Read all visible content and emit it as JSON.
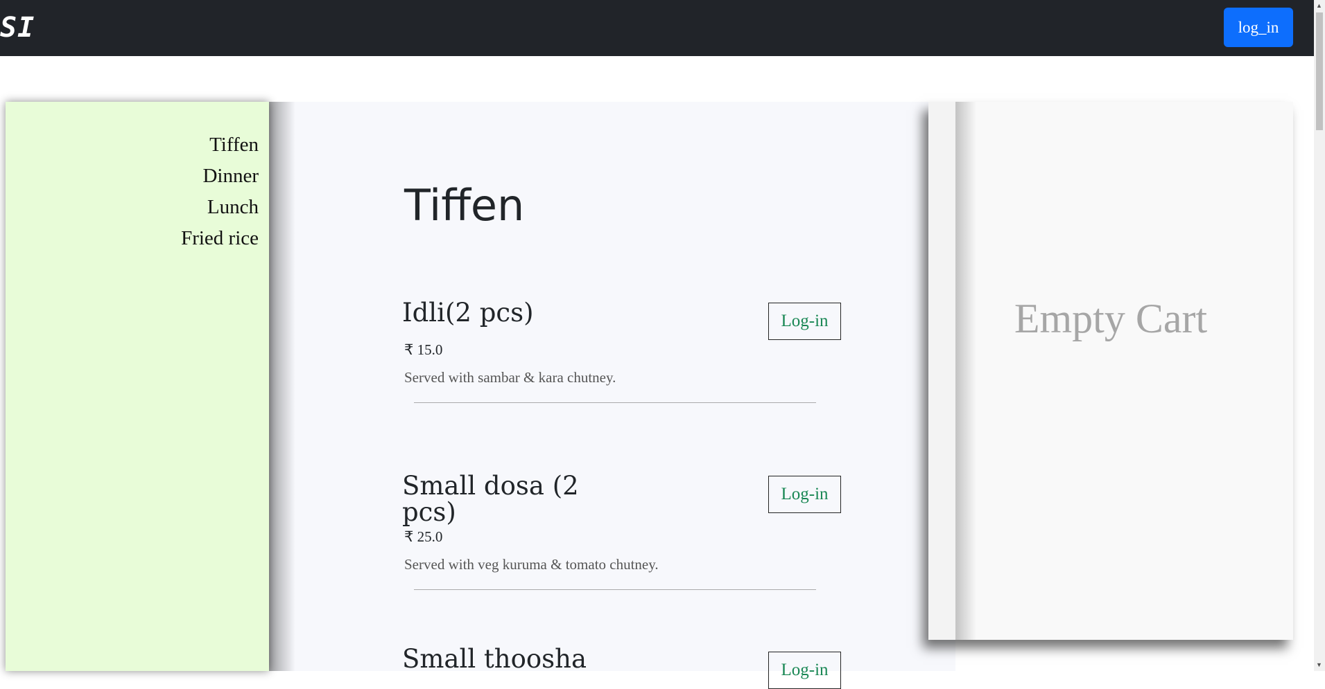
{
  "navbar": {
    "brand": "SI",
    "login_label": "log_in"
  },
  "sidebar": {
    "items": [
      {
        "label": "Tiffen"
      },
      {
        "label": "Dinner"
      },
      {
        "label": "Lunch"
      },
      {
        "label": "Fried rice"
      }
    ]
  },
  "main": {
    "section_title": "Tiffen",
    "items": [
      {
        "name": "Idli(2 pcs)",
        "price": "₹ 15.0",
        "description": "Served with sambar & kara chutney.",
        "button_label": "Log-in"
      },
      {
        "name": "Small dosa (2 pcs)",
        "price": "₹ 25.0",
        "description": "Served with veg kuruma & tomato chutney.",
        "button_label": "Log-in"
      },
      {
        "name": "Small thoosha",
        "button_label": "Log-in"
      }
    ]
  },
  "cart": {
    "empty_label": "Empty Cart"
  }
}
